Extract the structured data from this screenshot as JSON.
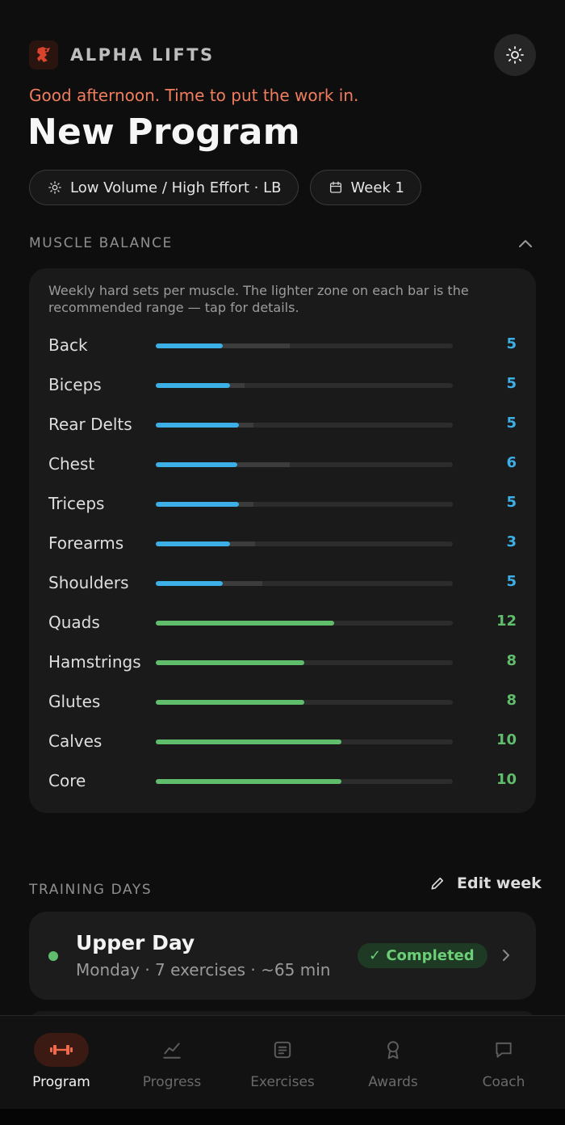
{
  "brand": {
    "name": "ALPHA LIFTS"
  },
  "greeting": "Good afternoon. Time to put the work in.",
  "program": {
    "title": "New Program",
    "style_chip": "Low Volume / High Effort · LB",
    "week_chip": "Week 1"
  },
  "balance": {
    "section_label": "MUSCLE BALANCE",
    "description": "Weekly hard sets per muscle. The lighter zone on each bar is the recommended range — tap for details.",
    "max_sets": 20,
    "colors": {
      "under": "#3cb0e6",
      "in_range": "#5fbd6b"
    },
    "muscles": [
      {
        "name": "Back",
        "sets": "5",
        "level": 0.225,
        "zone": [
          0.225,
          0.45
        ],
        "status": "under"
      },
      {
        "name": "Biceps",
        "sets": "5",
        "level": 0.25,
        "zone": [
          0.25,
          0.3
        ],
        "status": "under"
      },
      {
        "name": "Rear Delts",
        "sets": "5",
        "level": 0.28,
        "zone": [
          0.28,
          0.33
        ],
        "status": "under"
      },
      {
        "name": "Chest",
        "sets": "6",
        "level": 0.275,
        "zone": [
          0.275,
          0.45
        ],
        "status": "under"
      },
      {
        "name": "Triceps",
        "sets": "5",
        "level": 0.28,
        "zone": [
          0.28,
          0.33
        ],
        "status": "under"
      },
      {
        "name": "Forearms",
        "sets": "3",
        "level": 0.25,
        "zone": [
          0.25,
          0.335
        ],
        "status": "under"
      },
      {
        "name": "Shoulders",
        "sets": "5",
        "level": 0.225,
        "zone": [
          0.225,
          0.36
        ],
        "status": "under"
      },
      {
        "name": "Quads",
        "sets": "12",
        "level": 0.6,
        "zone": [
          0.6,
          0.6
        ],
        "status": "in_range"
      },
      {
        "name": "Hamstrings",
        "sets": "8",
        "level": 0.5,
        "zone": [
          0.5,
          0.5
        ],
        "status": "in_range"
      },
      {
        "name": "Glutes",
        "sets": "8",
        "level": 0.5,
        "zone": [
          0.5,
          0.5
        ],
        "status": "in_range"
      },
      {
        "name": "Calves",
        "sets": "10",
        "level": 0.625,
        "zone": [
          0.625,
          0.625
        ],
        "status": "in_range"
      },
      {
        "name": "Core",
        "sets": "10",
        "level": 0.625,
        "zone": [
          0.625,
          0.625
        ],
        "status": "in_range"
      }
    ]
  },
  "training_days": {
    "section_label": "TRAINING DAYS",
    "edit_label": "Edit week",
    "days": [
      {
        "title": "Upper Day",
        "subtitle": "Monday · 7 exercises · ~65 min",
        "status": "✓ Completed"
      }
    ]
  },
  "tabs": [
    {
      "label": "Program",
      "icon": "dumbbell-icon",
      "active": true
    },
    {
      "label": "Progress",
      "icon": "chart-line-icon",
      "active": false
    },
    {
      "label": "Exercises",
      "icon": "list-icon",
      "active": false
    },
    {
      "label": "Awards",
      "icon": "award-icon",
      "active": false
    },
    {
      "label": "Coach",
      "icon": "chat-icon",
      "active": false
    }
  ]
}
